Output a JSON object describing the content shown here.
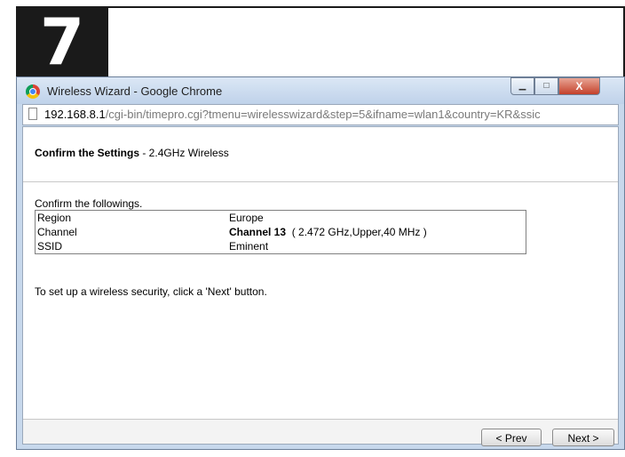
{
  "step": {
    "number": "7"
  },
  "window": {
    "title": "Wireless Wizard - Google Chrome",
    "controls": {
      "minimize": "▁",
      "maximize": "□",
      "close": "X"
    }
  },
  "address": {
    "host": "192.168.8.1",
    "path": "/cgi-bin/timepro.cgi?tmenu=wirelesswizard&step=5&ifname=wlan1&country=KR&ssic"
  },
  "page": {
    "title_bold": "Confirm the Settings",
    "title_rest": " - 2.4GHz Wireless",
    "intro": "Confirm the followings.",
    "rows": [
      {
        "key": "Region",
        "value_bold": "",
        "value": "Europe"
      },
      {
        "key": "Channel",
        "value_bold": "Channel 13",
        "value": "  ( 2.472 GHz,Upper,40 MHz )"
      },
      {
        "key": "SSID",
        "value_bold": "",
        "value": "Eminent"
      }
    ],
    "hint": "To set up a wireless security, click a 'Next' button."
  },
  "footer": {
    "prev_label": "< Prev",
    "next_label": "Next >"
  }
}
